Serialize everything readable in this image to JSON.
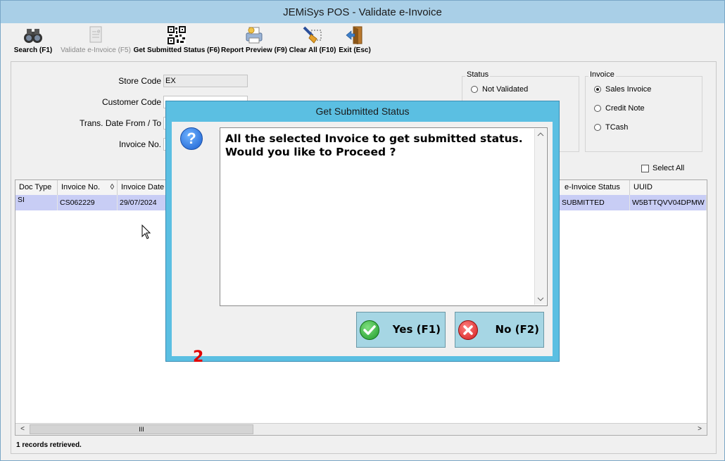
{
  "window": {
    "title": "JEMiSys POS - Validate e-Invoice"
  },
  "toolbar": {
    "search": "Search (F1)",
    "validate": "Validate e-Invoice (F5)",
    "get_status": "Get Submitted Status (F6)",
    "report_preview": "Report Preview (F9)",
    "clear_all": "Clear All (F10)",
    "exit": "Exit (Esc)"
  },
  "filters": {
    "store_code_label": "Store Code",
    "store_code_value": "EX",
    "customer_code_label": "Customer Code",
    "trans_date_label": "Trans. Date From / To",
    "invoice_no_label": "Invoice No."
  },
  "status_group": {
    "title": "Status",
    "not_validated": "Not Validated"
  },
  "invoice_group": {
    "title": "Invoice",
    "options": [
      "Sales Invoice",
      "Credit Note",
      "TCash"
    ],
    "selected": "Sales Invoice"
  },
  "select_all_label": "Select All",
  "grid": {
    "columns": {
      "doc_type": "Doc Type",
      "invoice_no": "Invoice No.",
      "sort_mark": "◊",
      "invoice_date": "Invoice Date",
      "einvoice_status": "e-Invoice Status",
      "uuid": "UUID"
    },
    "rows": [
      {
        "doc_type": "SI",
        "invoice_no": "CS062229",
        "invoice_date": "29/07/2024",
        "einvoice_status": "SUBMITTED",
        "uuid": "W5BTTQVV04DPMW"
      }
    ],
    "scroll_thumb": "III"
  },
  "status_bar": "1 records retrieved.",
  "dialog": {
    "title": "Get Submitted Status",
    "message": "All the selected Invoice to get submitted status.\nWould you like to Proceed ?",
    "yes_label": "Yes (F1)",
    "no_label": "No (F2)",
    "counter": "2"
  },
  "colors": {
    "dialog_frame": "#5bbfe2",
    "row_selected": "#c8cdf5",
    "counter": "#e00000"
  }
}
